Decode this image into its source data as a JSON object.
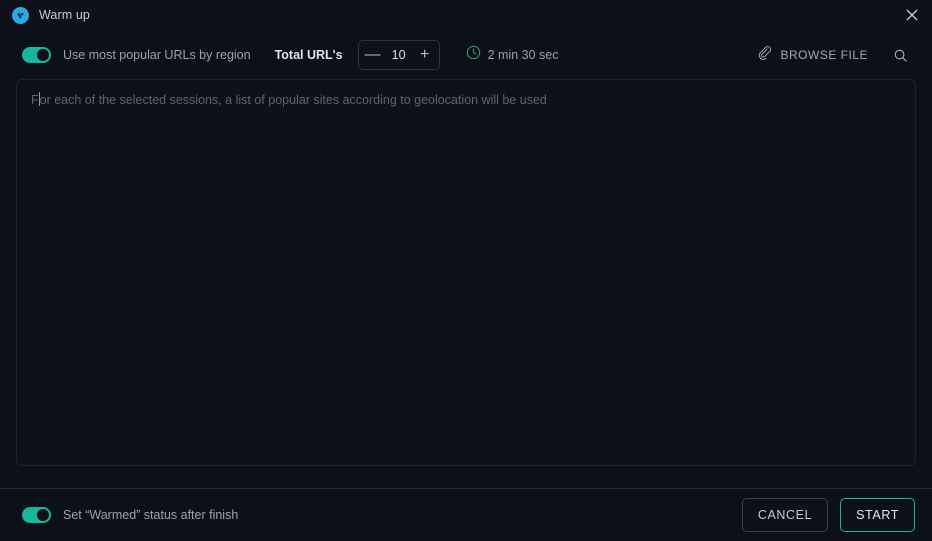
{
  "window": {
    "title": "Warm up",
    "logo_icon": "globe-swoosh-icon",
    "close_icon": "close-icon",
    "accent_color": "#16b79b",
    "logo_color": "#2aa9e0",
    "background_color": "#0b1019"
  },
  "toolbar": {
    "popular_urls_toggle": {
      "label": "Use most popular URLs by region",
      "state": "on"
    },
    "total_urls": {
      "label": "Total URL's",
      "value": "10",
      "decrement_label": "—",
      "increment_label": "+"
    },
    "duration": {
      "icon": "clock-icon",
      "text": "2 min 30 sec"
    },
    "browse_file": {
      "icon": "paperclip-icon",
      "label": "BROWSE FILE"
    },
    "search": {
      "icon": "search-icon"
    }
  },
  "editor": {
    "placeholder_before_caret": "F",
    "placeholder_after_caret": "or each of the selected sessions, a list of popular sites according to geolocation will be used",
    "value": ""
  },
  "footer": {
    "warmed_toggle": {
      "label": "Set “Warmed” status after finish",
      "state": "on"
    },
    "cancel_label": "CANCEL",
    "start_label": "START"
  }
}
